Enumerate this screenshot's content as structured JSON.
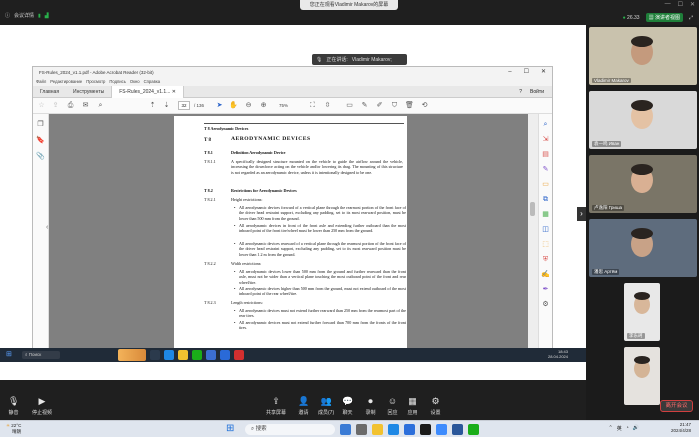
{
  "meeting": {
    "top_left_items": [
      "会议详情"
    ],
    "share_banner": "您正在观看Vladimir Makarov的屏幕",
    "signal": "26.33",
    "view_label": "演讲者视图",
    "speaking_prefix": "正在讲话:",
    "speaking_name": "Vladimir Makarov;",
    "toolbar": [
      {
        "icon": "mic-icon",
        "label": "静音"
      },
      {
        "icon": "video-off-icon",
        "label": "停止视频"
      },
      {
        "icon": "share-icon",
        "label": "共享屏幕"
      },
      {
        "icon": "invite-icon",
        "label": "邀请"
      },
      {
        "icon": "members-icon",
        "label": "成员(7)"
      },
      {
        "icon": "chat-icon",
        "label": "聊天"
      },
      {
        "icon": "record-icon",
        "label": "录制"
      },
      {
        "icon": "reaction-icon",
        "label": "回应"
      },
      {
        "icon": "apps-icon",
        "label": "应用"
      },
      {
        "icon": "settings-icon",
        "label": "设置"
      }
    ],
    "leave_label": "离开会议",
    "participants": [
      {
        "name": "Vladimir Makarov",
        "bg": "#c9c2ad",
        "face": "#c49a7d"
      },
      {
        "name": "袁一鸣 Иван",
        "bg": "#d9d9d9",
        "face": "#e4c2a4"
      },
      {
        "name": "卢逸阳 Гриша",
        "bg": "#7a7567",
        "face": "#d9b093"
      },
      {
        "name": "潘思 Артём",
        "bg": "#5e6c7d",
        "face": "#c8a287"
      },
      {
        "name": "李东珂",
        "bg": "#e8e8e8",
        "face": "#d8b79a"
      },
      {
        "name": "",
        "bg": "#e5e2de",
        "face": "#d4b496"
      }
    ]
  },
  "acrobat": {
    "title": "FS-Rules_2024_v1.1.pdf - Adobe Acrobat Reader (32-bit)",
    "menu": [
      "Файл",
      "Редактирование",
      "Просмотр",
      "Подпись",
      "Окно",
      "Справка"
    ],
    "tabs": [
      "Главная",
      "Инструменты",
      "FS-Rules_2024_v1.1..."
    ],
    "signin": "Войти",
    "page_current": "32",
    "page_total": "/ 136",
    "zoom": "75%"
  },
  "document": {
    "running_head": "T 8   Aerodynamic Devices",
    "title": "AERODYNAMIC DEVICES",
    "title_num": "T 8",
    "sections": [
      {
        "num": "T 8.1",
        "title": "Definition Aerodynamic Device"
      },
      {
        "num": "T 8.2",
        "title": "Restrictions for Aerodynamic Devices"
      }
    ],
    "t811_num": "T 8.1.1",
    "t811_text": "A specifically designed structure mounted on the vehicle to guide the airflow around the vehicle, increasing the downforce acting on the vehicle and/or lowering its drag. The mounting of this structure is not regarded as an aerodynamic device, unless it is intentionally designed to be one.",
    "t821_num": "T 8.2.1",
    "t821_label": "Height restrictions:",
    "t821_bullets": [
      "All aerodynamic devices forward of a vertical plane through the rearmost portion of the front face of the driver head restraint support, excluding any padding, set to its most rearward position, must be lower than 500 mm from the ground.",
      "All aerodynamic devices in front of the front axle and extending further outboard than the most inboard point of the front tire/wheel must be lower than 250 mm from the ground.",
      "All aerodynamic devices rearward of a vertical plane through the rearmost portion of the front face of the driver head restraint support, excluding any padding, set to its most rearward position must be lower than 1.2 m from the ground."
    ],
    "t822_num": "T 8.2.2",
    "t822_label": "Width restrictions:",
    "t822_bullets": [
      "All aerodynamic devices lower than 500 mm from the ground and further rearward than the front axle, must not be wider than a vertical plane touching the most outboard point of the front and rear wheel/tire.",
      "All aerodynamic devices higher than 500 mm from the ground, must not extend outboard of the most inboard point of the rear wheel/tire."
    ],
    "t823_num": "T 8.2.3",
    "t823_label": "Length restrictions:",
    "t823_bullets": [
      "All aerodynamic devices must not extend further rearward than 250 mm from the rearmost part of the rear tires.",
      "All aerodynamic devices must not extend further forward than 700 mm from the fronts of the front tires."
    ]
  },
  "remote_taskbar": {
    "search": "Поиск",
    "time": "18:43",
    "date": "28.04.2024"
  },
  "windows_taskbar": {
    "weather_temp": "22°C",
    "weather_desc": "晴朗",
    "search": "搜索",
    "lang": "英",
    "time": "21:47",
    "date": "2024/4/28"
  }
}
